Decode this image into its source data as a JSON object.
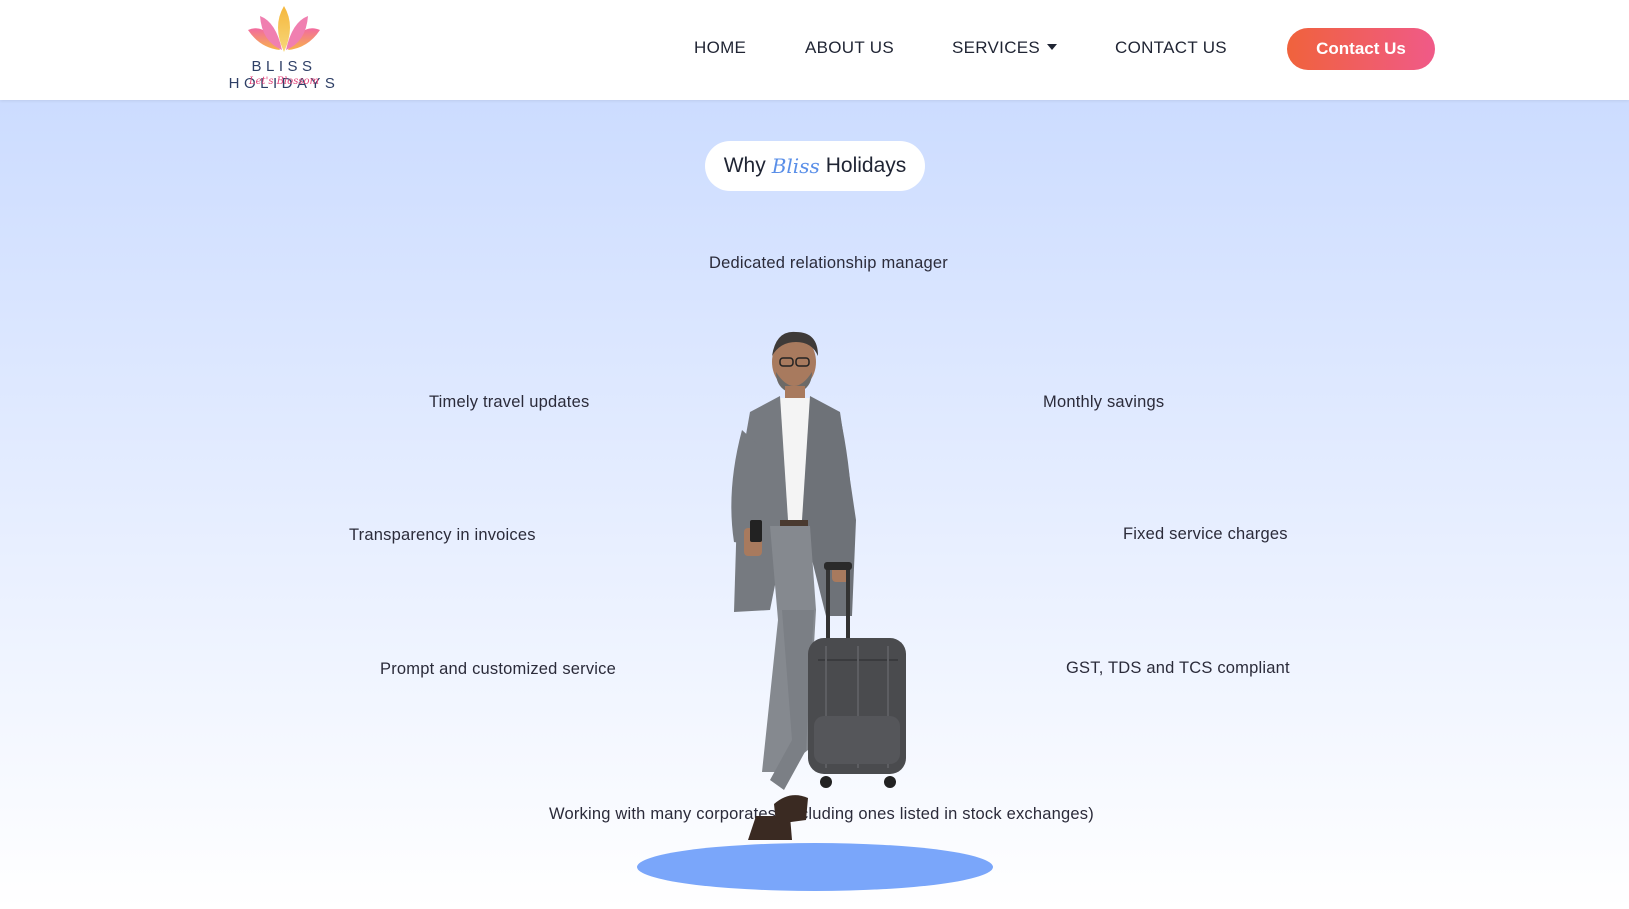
{
  "brand": {
    "name": "BLISS HOLIDAYS",
    "tagline": "Let's Blossom"
  },
  "nav": {
    "home": "HOME",
    "about": "ABOUT US",
    "services": "SERVICES",
    "contact": "CONTACT US",
    "cta": "Contact Us"
  },
  "why": {
    "prefix": "Why",
    "accent": "Bliss",
    "suffix": "Holidays"
  },
  "features": {
    "top": "Dedicated relationship manager",
    "left1": "Timely travel updates",
    "right1": "Monthly savings",
    "left2": "Transparency in invoices",
    "right2": "Fixed service charges",
    "left3": "Prompt and customized service",
    "right3": "GST, TDS and TCS compliant",
    "bottom": "Working with many corporates (including ones listed in stock exchanges)"
  },
  "colors": {
    "accent": "#5a8fe8",
    "cta_start": "#f0623c",
    "cta_end": "#f05a88",
    "platform": "#7aa6fa"
  }
}
